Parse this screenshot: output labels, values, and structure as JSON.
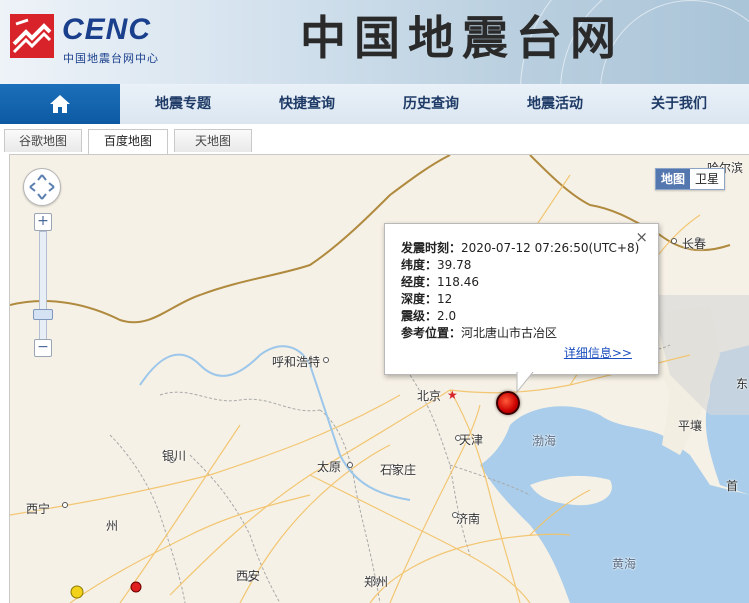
{
  "header": {
    "logo_text": "CENC",
    "logo_subtitle": "中国地震台网中心",
    "site_title": "中国地震台网"
  },
  "nav": {
    "home_icon": "home-icon",
    "items": [
      {
        "label": "地震专题"
      },
      {
        "label": "快捷查询"
      },
      {
        "label": "历史查询"
      },
      {
        "label": "地震活动"
      },
      {
        "label": "关于我们"
      }
    ]
  },
  "map_tabs": [
    {
      "label": "谷歌地图",
      "active": false
    },
    {
      "label": "百度地图",
      "active": true
    },
    {
      "label": "天地图",
      "active": false
    }
  ],
  "map": {
    "type_toggle": {
      "map": "地图",
      "satellite": "卫星",
      "selected": "地图"
    },
    "zoom_in": "+",
    "zoom_out": "−",
    "places": {
      "harbin": "哈尔滨",
      "changchun": "长春",
      "hohhot": "呼和浩特",
      "beijing": "北京",
      "tianjin": "天津",
      "yinchuan": "银川",
      "taiyuan": "太原",
      "shijiazhuang": "石家庄",
      "xining": "西宁",
      "jinan": "济南",
      "xian": "西安",
      "zhengzhou": "郑州",
      "bohai": "渤海",
      "huanghai": "黄海",
      "pyongyang": "平壤",
      "gyeongbuk": "首",
      "lanzhou": "州",
      "east_edge": "东"
    },
    "colors": {
      "land": "#f6f1e6",
      "sea": "#a9cdea",
      "border": "#b08a3e",
      "road": "#f2c46d"
    }
  },
  "quake_info": {
    "close": "×",
    "time_label": "发震时刻：",
    "time_value": "2020-07-12 07:26:50(UTC+8)",
    "lat_label": "纬度：",
    "lat_value": "39.78",
    "lon_label": "经度：",
    "lon_value": "118.46",
    "depth_label": "深度：",
    "depth_value": "12",
    "mag_label": "震级：",
    "mag_value": "2.0",
    "loc_label": "参考位置：",
    "loc_value": "河北唐山市古冶区",
    "detail_link": "详细信息>>"
  }
}
